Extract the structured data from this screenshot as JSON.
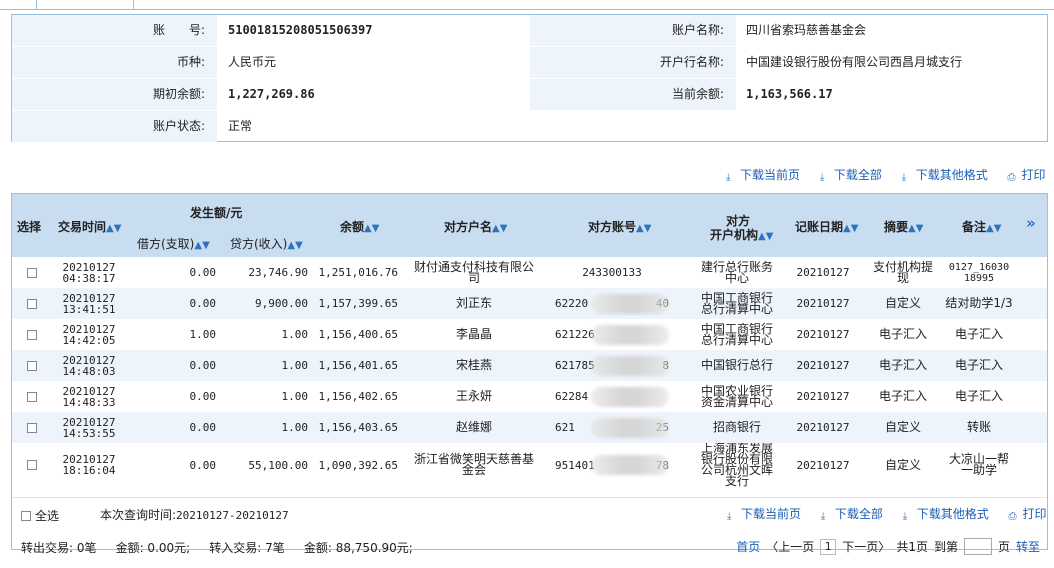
{
  "account": {
    "no_label": "账　　号:",
    "no": "51001815208051506397",
    "name_label": "账户名称:",
    "name": "四川省索玛慈善基金会",
    "currency_label": "币种:",
    "currency": "人民币元",
    "bank_label": "开户行名称:",
    "bank": "中国建设银行股份有限公司西昌月城支行",
    "opening_label": "期初余额:",
    "opening": "1,227,269.86",
    "current_label": "当前余额:",
    "current": "1,163,566.17",
    "status_label": "账户状态:",
    "status": "正常"
  },
  "toolbar": {
    "download_page": "下载当前页",
    "download_all": "下载全部",
    "download_other": "下载其他格式",
    "print": "打印"
  },
  "headers": {
    "select": "选择",
    "time": "交易时间",
    "amount_group": "发生额/元",
    "debit": "借方(支取)",
    "credit": "贷方(收入)",
    "balance": "余额",
    "party_name": "对方户名",
    "party_account": "对方账号",
    "party_bank_1": "对方",
    "party_bank_2": "开户机构",
    "post_date": "记账日期",
    "summary": "摘要",
    "remark": "备注",
    "more": "»"
  },
  "rows": [
    {
      "date": "20210127",
      "time": "04:38:17",
      "debit": "0.00",
      "credit": "23,746.90",
      "balance": "1,251,016.76",
      "name": "财付通支付科技有限公司",
      "acct": "243300133",
      "acct_pre": "",
      "acct_suf": "",
      "bank": "建行总行账务中心",
      "post": "20210127",
      "summary": "支付机构提现",
      "remark": "0127_16030 18995"
    },
    {
      "date": "20210127",
      "time": "13:41:51",
      "debit": "0.00",
      "credit": "9,900.00",
      "balance": "1,157,399.65",
      "name": "刘正东",
      "acct": "",
      "acct_pre": "62220",
      "acct_suf": "40",
      "bank": "中国工商银行总行清算中心",
      "post": "20210127",
      "summary": "自定义",
      "remark": "结对助学1/3"
    },
    {
      "date": "20210127",
      "time": "14:42:05",
      "debit": "1.00",
      "credit": "1.00",
      "balance": "1,156,400.65",
      "name": "李晶晶",
      "acct": "",
      "acct_pre": "621226",
      "acct_suf": "",
      "bank": "中国工商银行总行清算中心",
      "post": "20210127",
      "summary": "电子汇入",
      "remark": "电子汇入"
    },
    {
      "date": "20210127",
      "time": "14:48:03",
      "debit": "0.00",
      "credit": "1.00",
      "balance": "1,156,401.65",
      "name": "宋桂燕",
      "acct": "",
      "acct_pre": "621785",
      "acct_suf": "8",
      "bank": "中国银行总行",
      "post": "20210127",
      "summary": "电子汇入",
      "remark": "电子汇入"
    },
    {
      "date": "20210127",
      "time": "14:48:33",
      "debit": "0.00",
      "credit": "1.00",
      "balance": "1,156,402.65",
      "name": "王永妍",
      "acct": "",
      "acct_pre": "62284",
      "acct_suf": "",
      "bank": "中国农业银行资金清算中心",
      "post": "20210127",
      "summary": "电子汇入",
      "remark": "电子汇入"
    },
    {
      "date": "20210127",
      "time": "14:53:55",
      "debit": "0.00",
      "credit": "1.00",
      "balance": "1,156,403.65",
      "name": "赵维娜",
      "acct": "",
      "acct_pre": "621",
      "acct_suf": "25",
      "bank": "招商银行",
      "post": "20210127",
      "summary": "自定义",
      "remark": "转账"
    },
    {
      "date": "20210127",
      "time": "18:16:04",
      "debit": "0.00",
      "credit": "55,100.00",
      "balance": "1,090,392.65",
      "name": "浙江省微笑明天慈善基金会",
      "acct": "",
      "acct_pre": "951401",
      "acct_suf": "78",
      "bank": "上海浦东发展银行股份有限公司杭州文晖支行",
      "post": "20210127",
      "summary": "自定义",
      "remark": "大凉山一帮一助学"
    }
  ],
  "footer": {
    "select_all": "全选",
    "query_label": "本次查询时间:",
    "query_range": "20210127-20210127",
    "out_count": "转出交易: 0笔",
    "out_amount": "金额: 0.00元;",
    "in_count": "转入交易: 7笔",
    "in_amount": "金额: 88,750.90元;",
    "first": "首页",
    "prev": "〈上一页",
    "page": "1",
    "next": "下一页〉",
    "total": "共1页",
    "goto": "到第",
    "page_unit": "页",
    "go": "转至"
  }
}
